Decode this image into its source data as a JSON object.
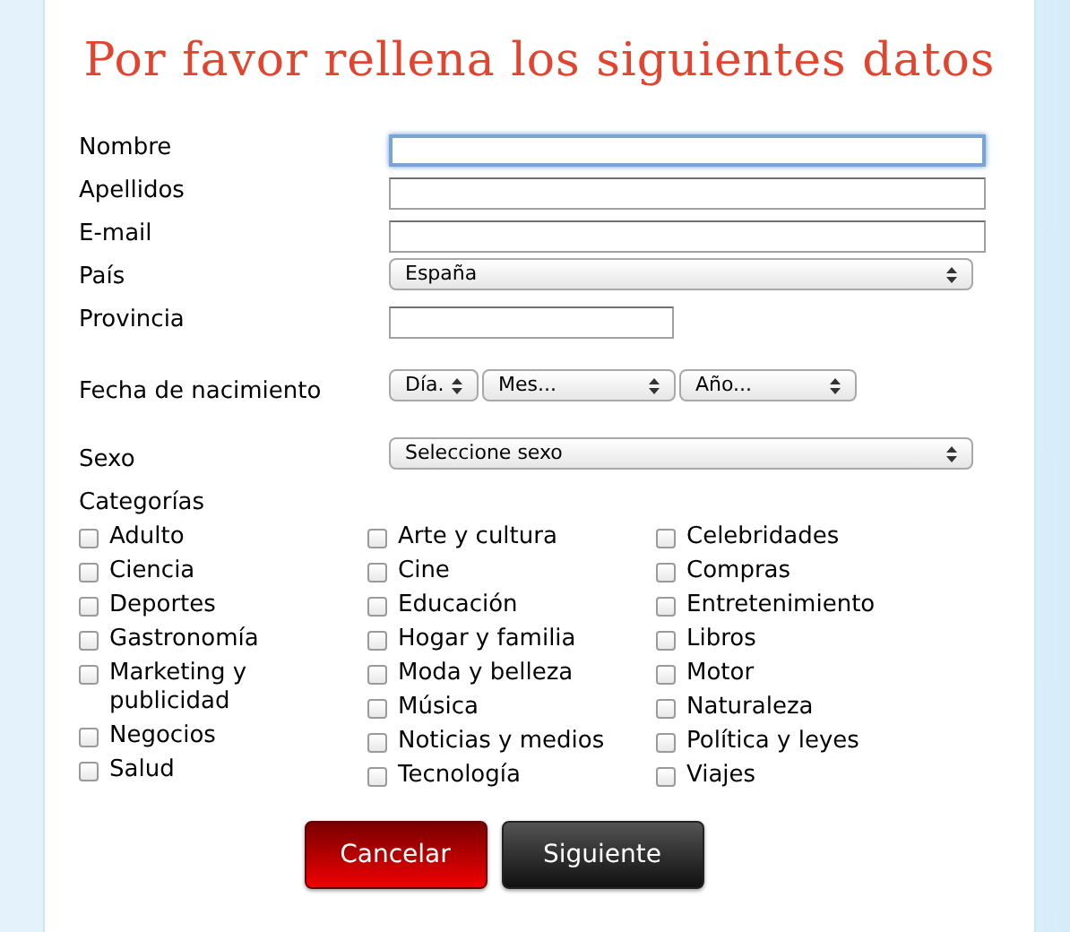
{
  "title": "Por favor rellena los siguientes datos",
  "fields": [
    {
      "kind": "text",
      "label": "Nombre",
      "focused": true
    },
    {
      "kind": "text",
      "label": "Apellidos",
      "focused": false
    },
    {
      "kind": "text",
      "label": "E-mail",
      "focused": false
    },
    {
      "kind": "select",
      "label": "País",
      "value": "España"
    },
    {
      "kind": "short",
      "label": "Provincia",
      "focused": false
    },
    {
      "kind": "date",
      "label": "Fecha de nacimiento",
      "parts": [
        "Día.",
        "Mes...",
        "Año..."
      ]
    },
    {
      "kind": "select",
      "label": "Sexo",
      "value": "Seleccione sexo"
    }
  ],
  "categories": {
    "label": "Categorías",
    "columns": [
      [
        {
          "label": "Adulto",
          "checked": false
        },
        {
          "label": "Ciencia",
          "checked": false
        },
        {
          "label": "Deportes",
          "checked": false
        },
        {
          "label": "Gastronomía",
          "checked": false
        },
        {
          "label": "Marketing y publicidad",
          "checked": false
        },
        {
          "label": "Negocios",
          "checked": false
        },
        {
          "label": "Salud",
          "checked": false
        }
      ],
      [
        {
          "label": "Arte y cultura",
          "checked": false
        },
        {
          "label": "Cine",
          "checked": false
        },
        {
          "label": "Educación",
          "checked": false
        },
        {
          "label": "Hogar y familia",
          "checked": false
        },
        {
          "label": "Moda y belleza",
          "checked": false
        },
        {
          "label": "Música",
          "checked": false
        },
        {
          "label": "Noticias y medios",
          "checked": false
        },
        {
          "label": "Tecnología",
          "checked": false
        }
      ],
      [
        {
          "label": "Celebridades",
          "checked": false
        },
        {
          "label": "Compras",
          "checked": false
        },
        {
          "label": "Entretenimiento",
          "checked": false
        },
        {
          "label": "Libros",
          "checked": false
        },
        {
          "label": "Motor",
          "checked": false
        },
        {
          "label": "Naturaleza",
          "checked": false
        },
        {
          "label": "Política y leyes",
          "checked": false
        },
        {
          "label": "Viajes",
          "checked": false
        }
      ]
    ]
  },
  "buttons": [
    {
      "kind": "danger",
      "label": "Cancelar"
    },
    {
      "kind": "dark",
      "label": "Siguiente"
    }
  ]
}
